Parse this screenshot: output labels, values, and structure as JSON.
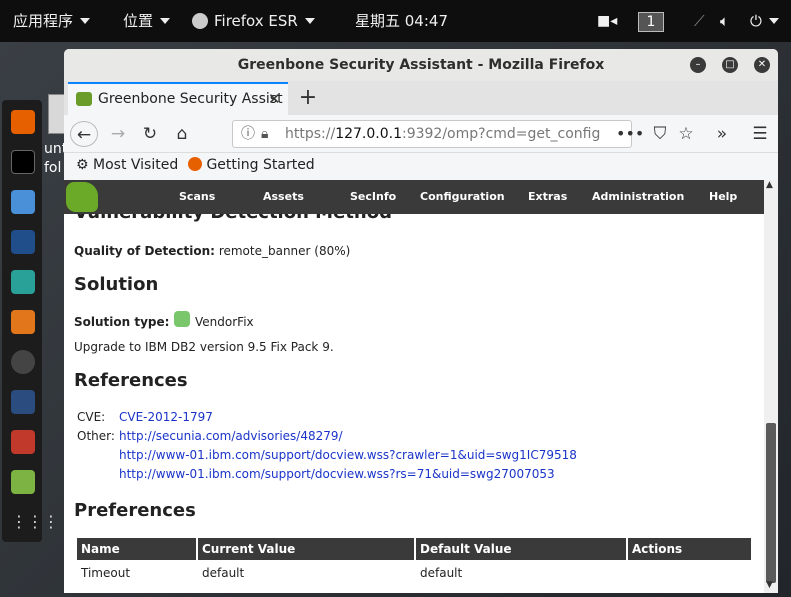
{
  "topbar": {
    "applications": "应用程序",
    "places": "位置",
    "firefox": "Firefox ESR",
    "clock": "星期五 04:47",
    "workspace": "1"
  },
  "desktop": {
    "item_label": "unt-\nfol"
  },
  "window": {
    "title": "Greenbone Security Assistant - Mozilla Firefox",
    "tab_title": "Greenbone Security Assist",
    "url_prefix": "https://",
    "url_host": "127.0.0.1",
    "url_rest": ":9392/omp?cmd=get_config",
    "bookmarks": [
      "Most Visited",
      "Getting Started"
    ]
  },
  "gsa_nav": [
    "Scans",
    "Assets",
    "SecInfo",
    "Configuration",
    "Extras",
    "Administration",
    "Help"
  ],
  "page": {
    "vdm_heading": "Vulnerability Detection Method",
    "qod_label": "Quality of Detection:",
    "qod_value": "remote_banner (80%)",
    "solution_heading": "Solution",
    "solution_type_label": "Solution type:",
    "solution_type_value": "VendorFix",
    "solution_text": "Upgrade to IBM DB2 version 9.5 Fix Pack 9.",
    "references_heading": "References",
    "cve_label": "CVE:",
    "cve_value": "CVE-2012-1797",
    "other_label": "Other:",
    "other_links": [
      "http://secunia.com/advisories/48279/",
      "http://www-01.ibm.com/support/docview.wss?crawler=1&uid=swg1IC79518",
      "http://www-01.ibm.com/support/docview.wss?rs=71&uid=swg27007053"
    ],
    "preferences_heading": "Preferences",
    "pref_headers": [
      "Name",
      "Current Value",
      "Default Value",
      "Actions"
    ],
    "pref_rows": [
      [
        "Timeout",
        "default",
        "default",
        ""
      ]
    ]
  },
  "colors": {
    "accent": "#0a84ff",
    "link": "#1a34c9",
    "gsa_bar": "#3a3a3a",
    "gsa_green": "#6aaa28"
  }
}
